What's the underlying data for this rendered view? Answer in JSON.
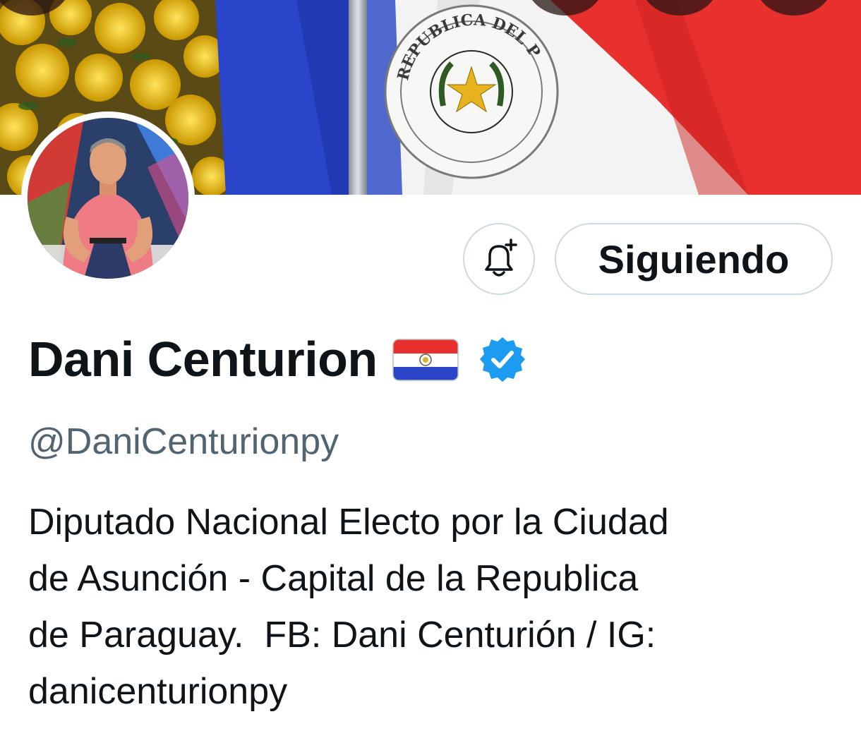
{
  "header": {
    "banner_alt": "Paraguay flag header image",
    "colors": {
      "flag_red": "#e8312f",
      "flag_white": "#f3f3f3",
      "flag_blue": "#2a45c9",
      "flowers_yellow": "#f4cc1f"
    },
    "seal_text": "REPUBLICA DEL PARAGUAY"
  },
  "actions": {
    "notify_icon": "bell-plus-icon",
    "follow_label": "Siguiendo"
  },
  "profile": {
    "display_name": "Dani Centurion",
    "flag_icon": "paraguay-flag-icon",
    "verified_icon": "verified-badge-icon",
    "verified_color": "#1d9bf0",
    "handle": "@DaniCenturionpy",
    "bio_lines": [
      "Diputado Nacional Electo por la Ciudad",
      "de Asunción - Capital de la Republica",
      "de Paraguay.  FB: Dani Centurión / IG:",
      "danicenturionpy"
    ]
  }
}
